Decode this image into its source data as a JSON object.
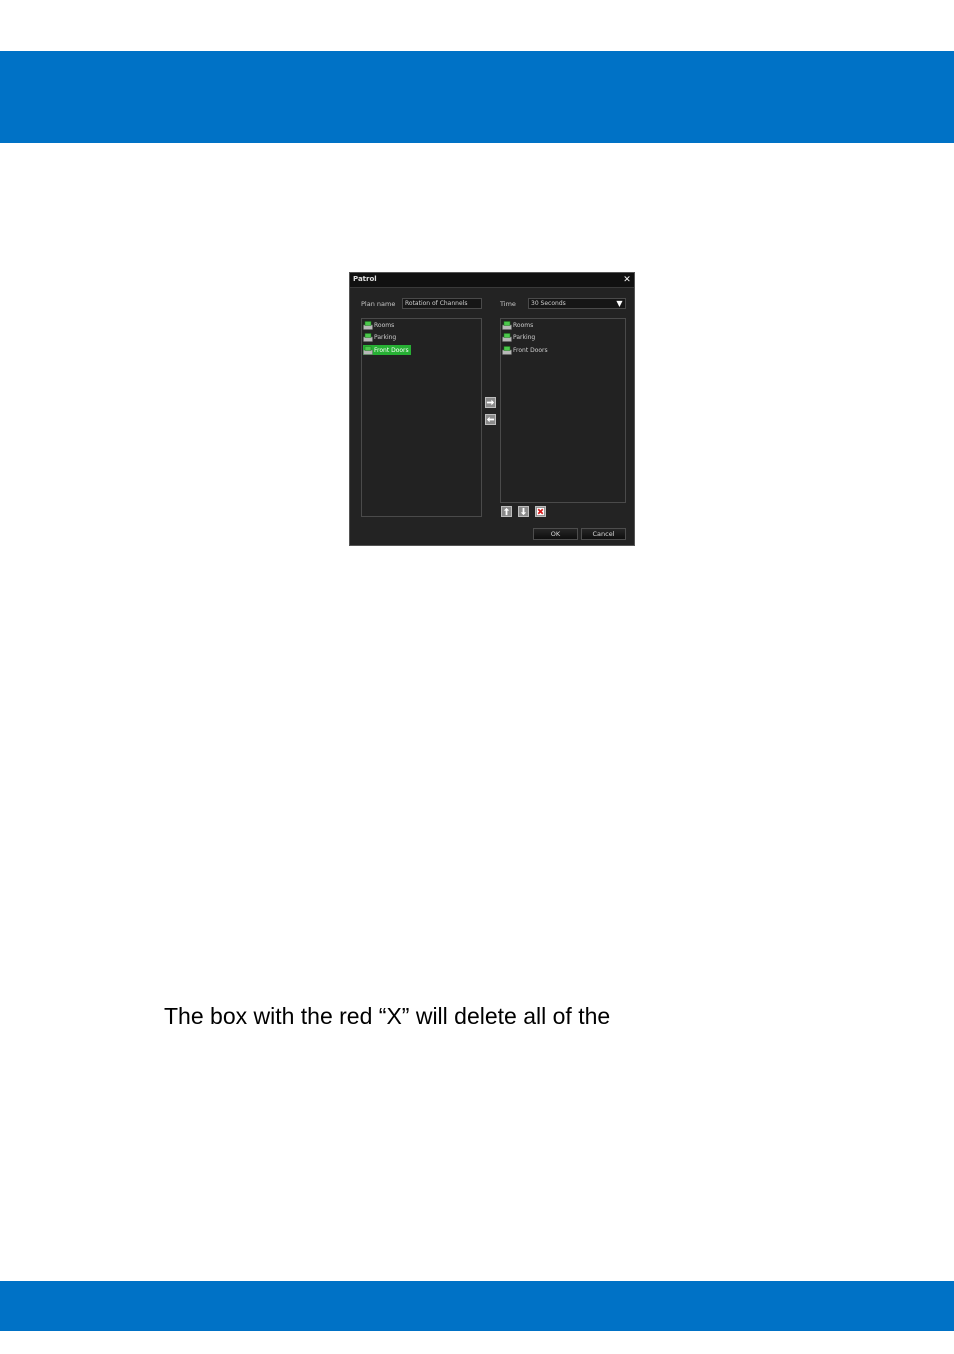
{
  "page": {
    "band_color": "#0072c6"
  },
  "dialog": {
    "title": "Patrol",
    "plan_name_label": "Plan name",
    "plan_name_value": "Rotation of Channels",
    "time_label": "Time",
    "time_value": "30 Seconds",
    "available_channels": [
      {
        "label": "Rooms",
        "selected": false
      },
      {
        "label": "Parking",
        "selected": false
      },
      {
        "label": "Front Doors",
        "selected": true
      }
    ],
    "patrol_channels": [
      {
        "label": "Rooms"
      },
      {
        "label": "Parking"
      },
      {
        "label": "Front Doors"
      }
    ],
    "ok_label": "OK",
    "cancel_label": "Cancel",
    "highlight_color": "#27b034"
  },
  "body_text": {
    "caption": "The box with the red “X” will delete all of the"
  }
}
